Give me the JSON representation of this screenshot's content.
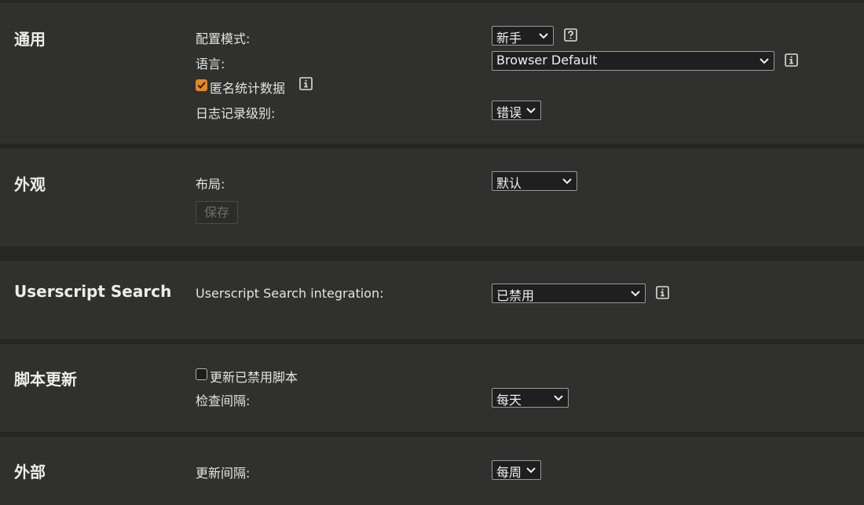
{
  "sections": {
    "general": {
      "title": "通用",
      "config_mode": {
        "label": "配置模式:",
        "value": "新手"
      },
      "language": {
        "label": "语言:",
        "value": "Browser Default"
      },
      "anonymous_stats": {
        "label": "匿名统计数据",
        "checked": true
      },
      "log_level": {
        "label": "日志记录级别:",
        "value": "错误"
      }
    },
    "appearance": {
      "title": "外观",
      "layout": {
        "label": "布局:",
        "value": "默认"
      },
      "save_label": "保存"
    },
    "userscript_search": {
      "title": "Userscript Search",
      "integration": {
        "label": "Userscript Search integration:",
        "value": "已禁用"
      }
    },
    "script_update": {
      "title": "脚本更新",
      "update_disabled": {
        "label": "更新已禁用脚本",
        "checked": false
      },
      "check_interval": {
        "label": "检查间隔:",
        "value": "每天"
      }
    },
    "external": {
      "title": "外部",
      "update_interval": {
        "label": "更新间隔:",
        "value": "每周"
      }
    }
  },
  "icons": {
    "help": "help-icon",
    "info": "info-icon",
    "chevron": "chevron-down-icon"
  },
  "colors": {
    "accent": "#e8871e",
    "panel": "#30302e",
    "background": "#262624"
  }
}
